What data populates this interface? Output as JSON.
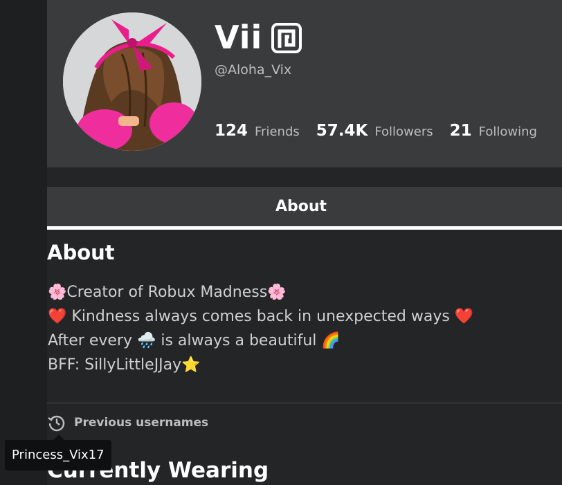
{
  "profile": {
    "display_name": "Vii",
    "username": "@Aloha_Vix",
    "stats": [
      {
        "count": "124",
        "label": "Friends"
      },
      {
        "count": "57.4K",
        "label": "Followers"
      },
      {
        "count": "21",
        "label": "Following"
      }
    ]
  },
  "tabs": [
    {
      "label": "About"
    }
  ],
  "about": {
    "heading": "About",
    "bio": [
      "🌸Creator of Robux Madness🌸",
      "❤️ Kindness always comes back in unexpected ways ❤️",
      "After every 🌧️ is always a beautiful 🌈",
      "BFF: SillyLittleJJay⭐"
    ]
  },
  "previous_usernames": {
    "label": "Previous usernames",
    "tooltip": "Princess_Vix17"
  },
  "sections": {
    "currently_wearing": "Currently Wearing"
  },
  "icons": {
    "premium": "premium-badge-icon",
    "history": "history-clock-icon"
  },
  "colors": {
    "page_bg": "#232527",
    "card_bg": "#393b3d",
    "tab_underline": "#ffffff",
    "secondary_text": "#bdbebe",
    "bow_pink": "#e91e8c"
  }
}
